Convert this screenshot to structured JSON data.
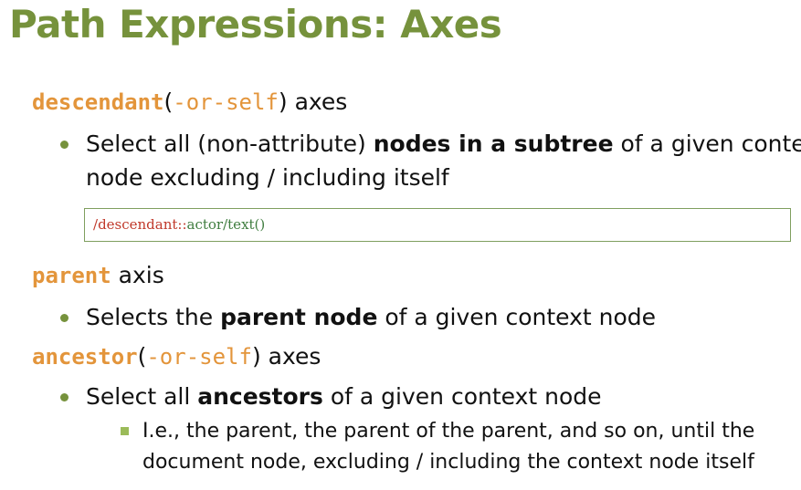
{
  "slide": {
    "title": "Path Expressions: Axes"
  },
  "sections": [
    {
      "keyword": "descendant",
      "optional_suffix": "-or-self",
      "open_paren": "(",
      "close_paren": ")",
      "label": " axes",
      "bullet": {
        "line1_pre": "Select all (non-attribute) ",
        "line1_bold": "nodes in a subtree",
        "line1_post": " of a given context",
        "line2": "node excluding / including itself"
      },
      "code": {
        "root_slash": "/",
        "axis": "descendant::",
        "path": "actor/text()"
      }
    },
    {
      "keyword": "parent",
      "label": " axis",
      "bullet": {
        "pre": "Selects the ",
        "bold": "parent node",
        "post": " of a given context node"
      }
    },
    {
      "keyword": "ancestor",
      "optional_suffix": "-or-self",
      "open_paren": "(",
      "close_paren": ")",
      "label": " axes",
      "bullet": {
        "pre": "Select all ",
        "bold": "ancestors",
        "post": " of a given context node"
      },
      "sub_bullet": {
        "line1": "I.e., the parent, the parent of the parent, and so on, until the",
        "line2": "document node, excluding / including the context node itself"
      }
    }
  ],
  "colors": {
    "title_green": "#76923c",
    "keyword_orange": "#e3953b",
    "bullet_green": "#76923c",
    "sub_bullet_green": "#9bbb59",
    "code_red": "#c0392b",
    "code_green": "#3f7d3f"
  }
}
